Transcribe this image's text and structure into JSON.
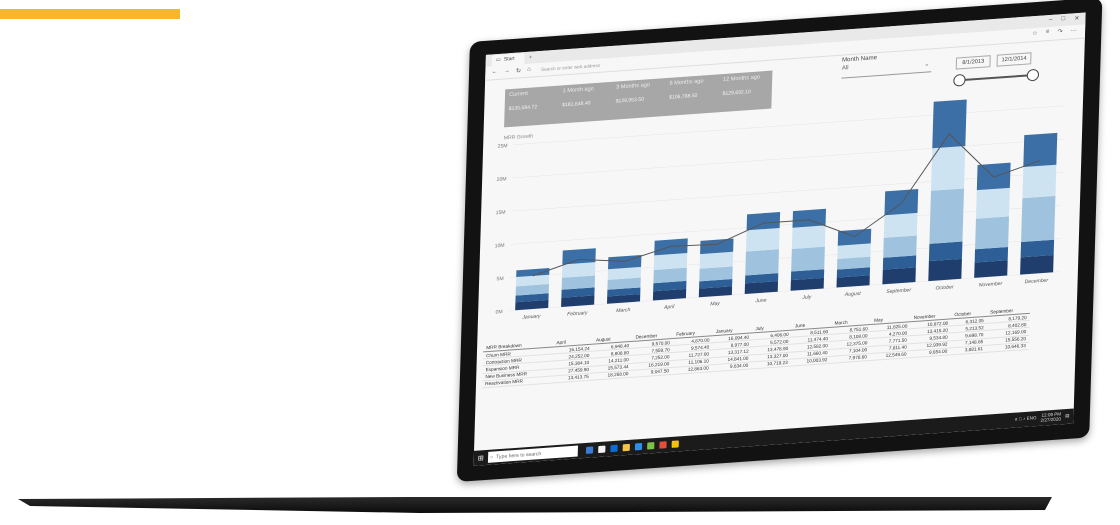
{
  "browser": {
    "tab_title": "Start",
    "new_tab": "+",
    "url_placeholder": "Search or enter web address",
    "nav": {
      "back": "←",
      "forward": "→",
      "refresh": "↻",
      "home": "⌂"
    },
    "window_controls": {
      "minimize": "–",
      "maximize": "□",
      "close": "✕"
    },
    "tools": {
      "favorite": "☆",
      "reading": "≡",
      "share": "↷",
      "more": "⋯"
    }
  },
  "kpis": [
    {
      "label": "Current",
      "value": "$135,584.72"
    },
    {
      "label": "1 Month ago",
      "value": "$181,648.40"
    },
    {
      "label": "3 Months ago",
      "value": "$129,953.50"
    },
    {
      "label": "6 Months ago",
      "value": "$106,788.50"
    },
    {
      "label": "12 Months ago",
      "value": "$129,692.10"
    }
  ],
  "filters": {
    "month_label": "Month Name",
    "month_value": "All",
    "date_start": "8/1/2013",
    "date_end": "12/1/2014"
  },
  "chart_data": {
    "type": "bar",
    "title": "MRR Growth",
    "ylabel": "",
    "ylim": [
      0,
      25
    ],
    "y_ticks": [
      "0M",
      "5M",
      "10M",
      "15M",
      "20M",
      "25M"
    ],
    "categories": [
      "January",
      "February",
      "March",
      "April",
      "May",
      "June",
      "July",
      "August",
      "September",
      "October",
      "November",
      "December"
    ],
    "stacked_totals": [
      6,
      8.5,
      7,
      9,
      8.5,
      12,
      12,
      8.5,
      14,
      27,
      17,
      21
    ],
    "segments": [
      {
        "color": "#1f3e6e",
        "values": [
          1.2,
          1.4,
          1.1,
          1.4,
          1.3,
          1.6,
          1.6,
          1.5,
          2.2,
          3.0,
          2.3,
          2.6
        ]
      },
      {
        "color": "#2d5f96",
        "values": [
          1.0,
          1.2,
          1.0,
          1.2,
          1.1,
          1.2,
          1.3,
          1.2,
          1.8,
          2.6,
          2.0,
          2.3
        ]
      },
      {
        "color": "#9fc3de",
        "values": [
          1.4,
          1.8,
          1.5,
          2.0,
          1.9,
          3.6,
          3.4,
          1.6,
          3.0,
          8.0,
          4.6,
          6.6
        ]
      },
      {
        "color": "#cde3f1",
        "values": [
          1.4,
          2.0,
          1.6,
          2.2,
          2.2,
          3.2,
          3.2,
          2.0,
          3.4,
          6.4,
          4.3,
          4.7
        ]
      },
      {
        "color": "#3c6fa6",
        "values": [
          1.0,
          2.1,
          1.8,
          2.2,
          2.0,
          2.4,
          2.5,
          2.2,
          3.6,
          7.0,
          3.8,
          4.8
        ]
      }
    ],
    "line": {
      "color": "#555555",
      "values": [
        5,
        7,
        6.2,
        8,
        7.8,
        10.5,
        10.5,
        7.5,
        12,
        22,
        15,
        17
      ]
    }
  },
  "table": {
    "headers": [
      "MRR Breakdown",
      "April",
      "August",
      "December",
      "February",
      "January",
      "July",
      "June",
      "March",
      "May",
      "November",
      "October",
      "September"
    ],
    "rows": [
      {
        "label": "Churn MRR",
        "values": [
          "16,154.24",
          "6,948.40",
          "9,570.00",
          "4,870.00",
          "16,094.40",
          "6,406.00",
          "8,511.60",
          "8,751.60",
          "11,825.00",
          "10,872.08",
          "6,312.05",
          "8,179.20"
        ]
      },
      {
        "label": "Contraction MRR",
        "values": [
          "24,252.00",
          "8,808.80",
          "7,559.70",
          "9,574.40",
          "8,977.00",
          "5,572.00",
          "11,474.40",
          "8,108.00",
          "4,270.00",
          "13,415.20",
          "5,213.52",
          "8,402.80"
        ]
      },
      {
        "label": "Expansion MRR",
        "values": [
          "15,384.10",
          "14,211.00",
          "7,252.00",
          "11,727.00",
          "13,317.12",
          "13,478.90",
          "12,582.00",
          "12,375.00",
          "7,771.50",
          "9,534.80",
          "9,698.70",
          "12,169.00"
        ]
      },
      {
        "label": "New Business MRR",
        "values": [
          "27,459.90",
          "15,573.44",
          "16,219.00",
          "11,106.10",
          "14,841.00",
          "13,327.00",
          "11,660.40",
          "7,104.00",
          "7,811.40",
          "12,939.92",
          "7,148.65",
          "15,556.20"
        ]
      },
      {
        "label": "Reactivation MRR",
        "values": [
          "13,413.75",
          "18,268.00",
          "9,047.50",
          "12,863.00",
          "9,634.00",
          "10,719.23",
          "10,003.92",
          "7,978.60",
          "12,549.60",
          "9,654.00",
          "3,881.61",
          "10,646.33"
        ]
      }
    ]
  },
  "taskbar": {
    "start": "⊞",
    "search_placeholder": "Type here to search",
    "search_icon": "○",
    "apps": [
      "#3a7bd5",
      "#f2f2f2",
      "#0a6ed1",
      "#f5c342",
      "#2f8ce8",
      "#7bc142",
      "#e74c3c",
      "#f4c20d"
    ],
    "tray": {
      "icons": "∧ □ ♪ ENG",
      "time": "12:09 PM",
      "date": "2/27/2020"
    }
  }
}
